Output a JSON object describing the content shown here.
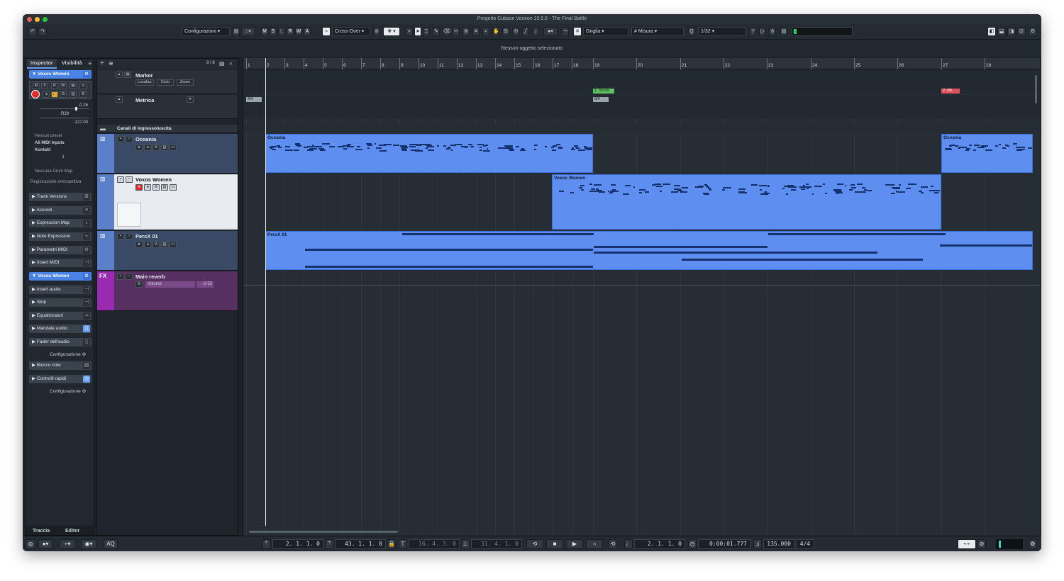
{
  "window": {
    "title": "Progetto Cubase Version 10.5.5 - The Final Battle"
  },
  "toolbar": {
    "config_label": "Configurazioni",
    "mode_letters": [
      "M",
      "S",
      "L",
      "R",
      "W",
      "A"
    ],
    "crossover_label": "Cross-Over",
    "grid_label": "Griglia",
    "measure_label": "Misura",
    "quantize_label": "1/32"
  },
  "info_line": {
    "text": "Nessun oggetto selezionato"
  },
  "inspector": {
    "tabs": [
      "Inspector",
      "Visibilità"
    ],
    "track_name": "Voxos Women",
    "volume": "-0.26",
    "pan": "R28",
    "delay": "-127.00",
    "preset": "Nessun preset",
    "input": "All MIDI Inputs",
    "output": "Kontakt",
    "channel": "1",
    "drum_map": "Nessuna Drum Map",
    "retro": "Registrazione retrospettiva",
    "sections": [
      "Track Versions",
      "Accordi",
      "Expression Map",
      "Note Expression",
      "Parametri MIDI",
      "Insert MIDI"
    ],
    "audio_track": "Voxos Women",
    "audio_sections": [
      "Insert audio",
      "Strip",
      "Equalizzatori",
      "Mandate audio",
      "Fader dell'audio"
    ],
    "config_label": "Configurazione",
    "extra_sections": [
      "Blocco note",
      "Controlli rapidi"
    ],
    "bottom_tabs": [
      "Traccia",
      "Editor"
    ]
  },
  "tracklist": {
    "count": "8 / 8",
    "marker_track": "Marker",
    "marker_btns": [
      "Localizz",
      "Ciclo",
      "Zoom"
    ],
    "signature_track": "Metrica",
    "folder_track": "Canali di ingresso/uscita",
    "tracks": [
      {
        "name": "Oceania",
        "color": "#5b7fc8"
      },
      {
        "name": "Voxos Women",
        "color": "#5b7fc8"
      },
      {
        "name": "PercX 01",
        "color": "#5b7fc8"
      },
      {
        "name": "Main reverb",
        "color": "#9a2bb0",
        "label": "FX",
        "param": "Volume",
        "param_value": "-2.53"
      }
    ]
  },
  "ruler": {
    "bars": [
      "1",
      "2",
      "3",
      "4",
      "5",
      "6",
      "7",
      "8",
      "9",
      "10",
      "11",
      "12",
      "13",
      "14",
      "15",
      "16",
      "17",
      "18",
      "19",
      "20",
      "21",
      "22",
      "23",
      "24",
      "25",
      "26",
      "27",
      "28"
    ]
  },
  "markers": {
    "sig_start": "4/4",
    "sig_mid": "9/4",
    "m1": "1. Strofa",
    "m2": "2. Rit."
  },
  "parts": [
    {
      "track": "Oceania",
      "name": "Oceania"
    },
    {
      "track": "Voxos Women",
      "name": "Voxos Women"
    },
    {
      "track": "PercX 01",
      "name": "PercX 01"
    },
    {
      "track": "Oceania",
      "name": "Oceania"
    }
  ],
  "transport": {
    "left_loc": "2. 1. 1.   0",
    "right_loc": "43. 1. 1.   0",
    "punch_in": "16. 4. 3.   0",
    "punch_out": "31. 4. 1.   0",
    "position": "2. 1. 1.   0",
    "time": "0:00:01.777",
    "tempo": "135.000",
    "signature": "4/4",
    "aq": "AQ"
  },
  "colors": {
    "part_blue": "#5e8ff0",
    "fx_purple": "#9a2bb0",
    "marker_green": "#5fc45f",
    "marker_red": "#e0505a"
  }
}
